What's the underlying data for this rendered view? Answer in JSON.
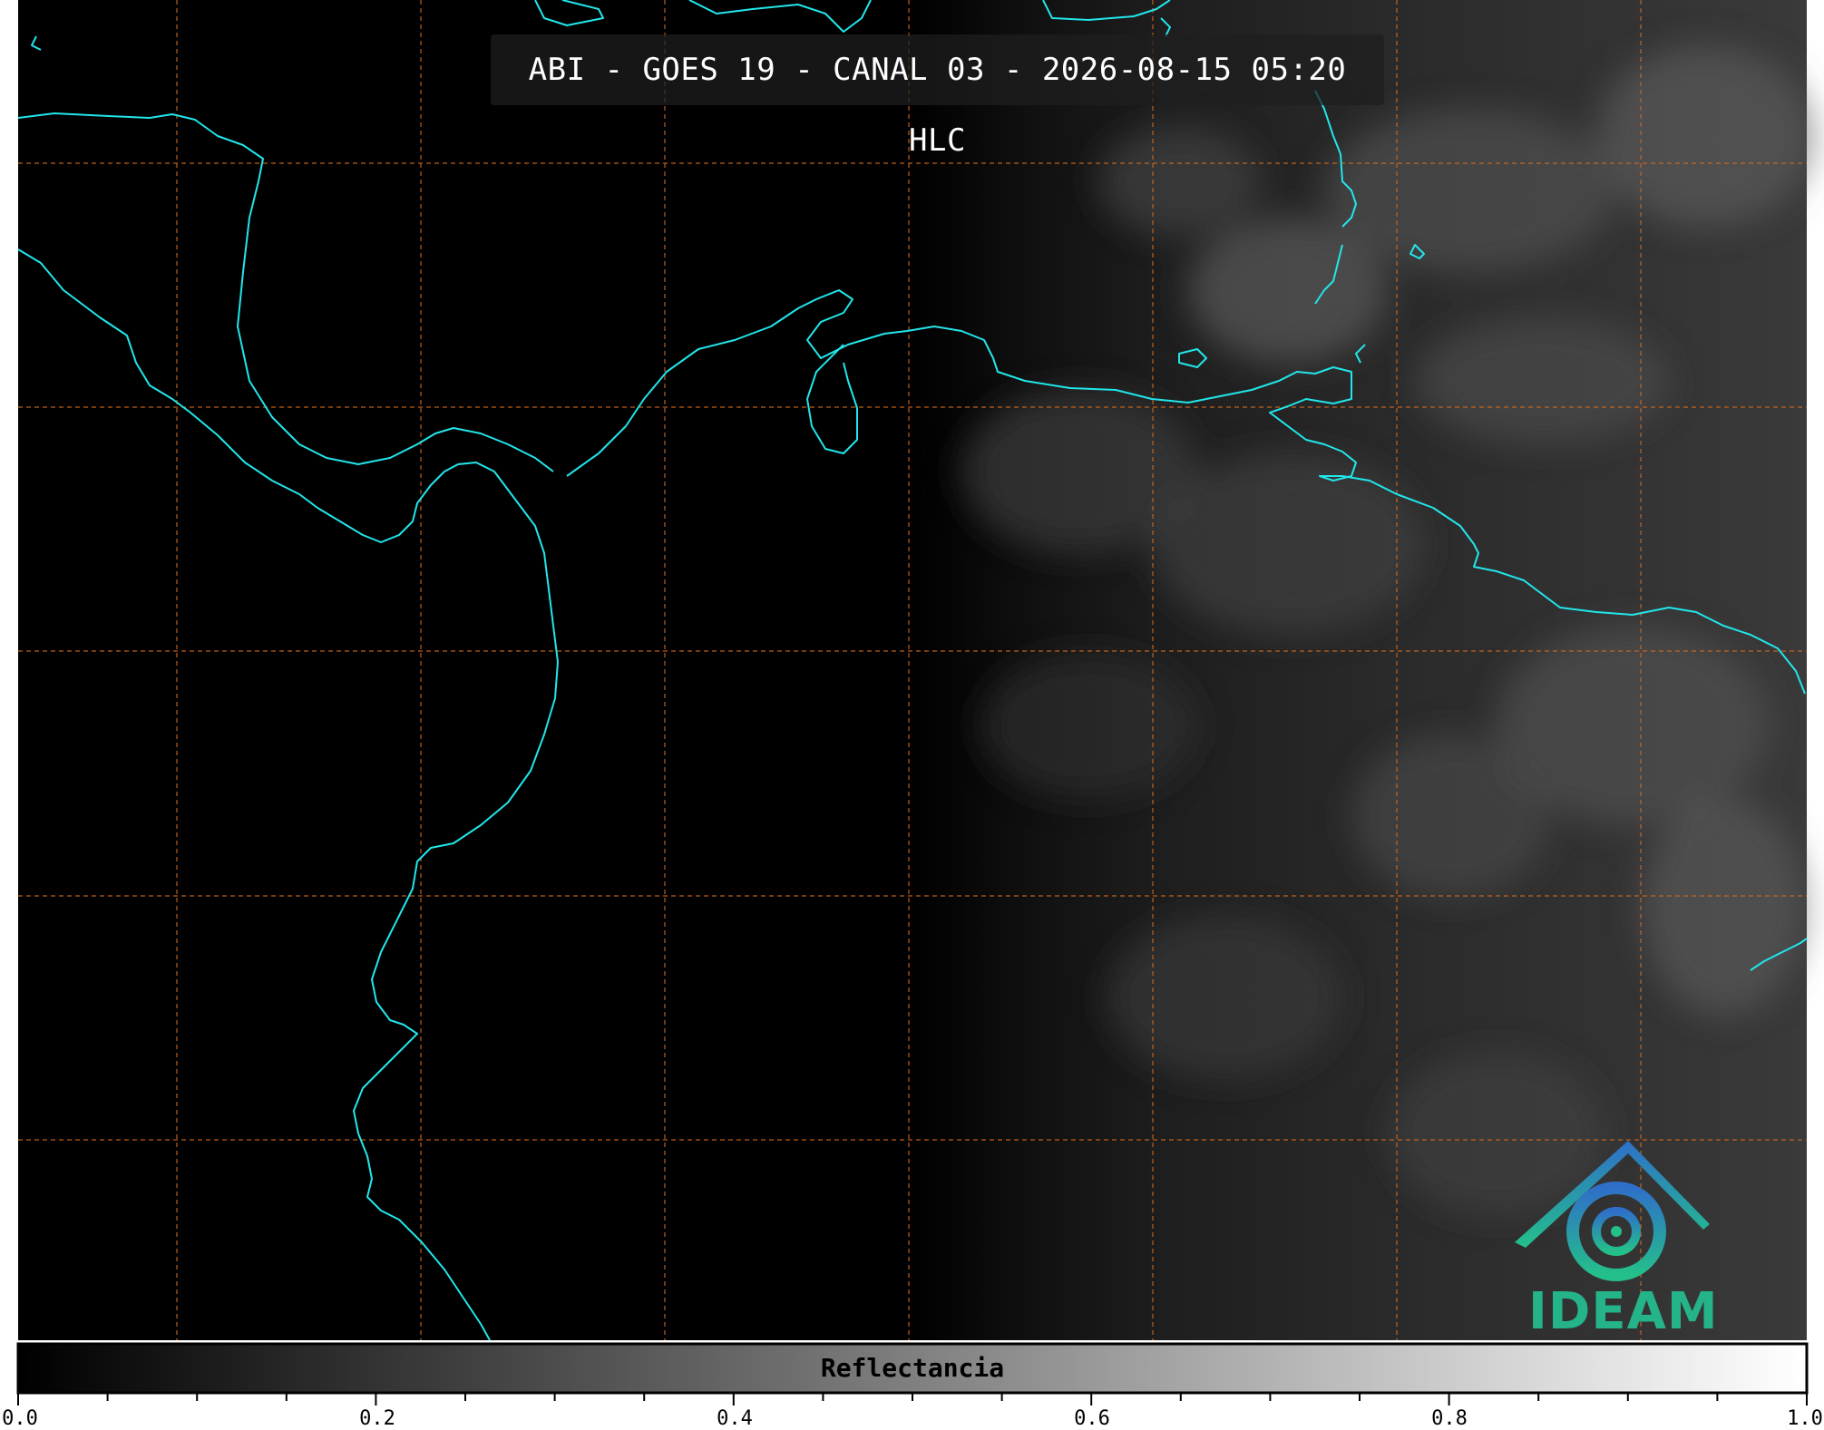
{
  "title": "ABI - GOES 19 - CANAL 03 - 2026-08-15 05:20 HLC",
  "colorbar": {
    "label": "Reflectancia",
    "ticks": [
      "0.0",
      "0.2",
      "0.4",
      "0.6",
      "0.8",
      "1.0"
    ],
    "range": [
      0.0,
      1.0
    ]
  },
  "logo": {
    "text": "IDEAM",
    "icon": "ideam-logo-icon"
  },
  "colors": {
    "coastline": "#22e6ea",
    "grid": "#d2691e",
    "logo": "#25b38a"
  }
}
